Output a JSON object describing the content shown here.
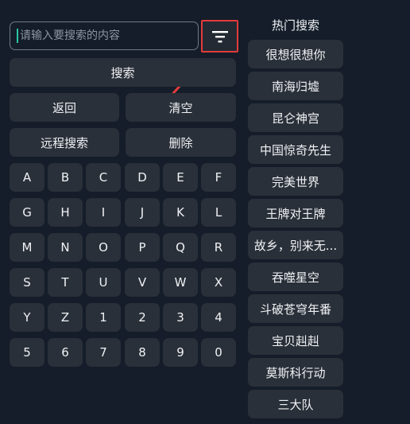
{
  "search": {
    "placeholder": "请输入要搜索的内容",
    "value": ""
  },
  "actions": {
    "search": "搜索",
    "back": "返回",
    "clear": "清空",
    "remote_search": "远程搜索",
    "delete": "删除"
  },
  "icons": {
    "filter": "filter-icon",
    "arrow": "annotation-arrow"
  },
  "colors": {
    "background": "#141d29",
    "button": "#2a3039",
    "highlight": "#e43b3b",
    "caret": "#2bc4a6"
  },
  "keyboard": {
    "keys": [
      "A",
      "B",
      "C",
      "D",
      "E",
      "F",
      "G",
      "H",
      "I",
      "J",
      "K",
      "L",
      "M",
      "N",
      "O",
      "P",
      "Q",
      "R",
      "S",
      "T",
      "U",
      "V",
      "W",
      "X",
      "Y",
      "Z",
      "1",
      "2",
      "3",
      "4",
      "5",
      "6",
      "7",
      "8",
      "9",
      "0"
    ]
  },
  "hot": {
    "title": "热门搜索",
    "items": [
      "很想很想你",
      "南海归墟",
      "昆仑神宫",
      "中国惊奇先生",
      "完美世界",
      "王牌对王牌",
      "故乡，别来无...",
      "吞噬星空",
      "斗破苍穹年番",
      "宝贝赳赳",
      "莫斯科行动",
      "三大队"
    ]
  }
}
